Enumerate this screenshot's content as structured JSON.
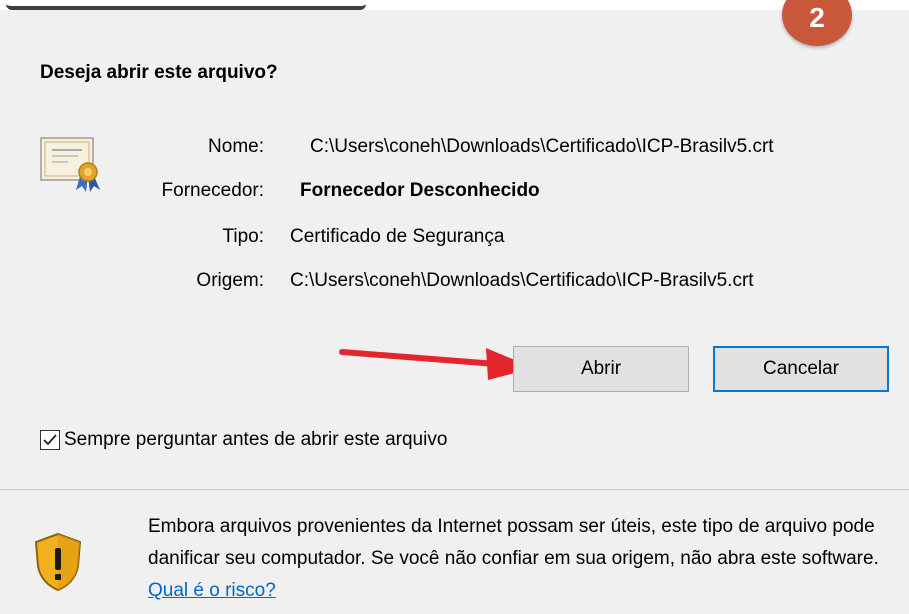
{
  "step_badge": "2",
  "dialog": {
    "title": "Deseja abrir este arquivo?",
    "fields": [
      {
        "label": "Nome:",
        "value": "C:\\Users\\coneh\\Downloads\\Certificado\\ICP-Brasilv5.crt",
        "bold": false
      },
      {
        "label": "Fornecedor:",
        "value": "Fornecedor Desconhecido",
        "bold": true
      },
      {
        "label": "Tipo:",
        "value": "Certificado de Segurança",
        "bold": false
      },
      {
        "label": "Origem:",
        "value": "C:\\Users\\coneh\\Downloads\\Certificado\\ICP-Brasilv5.crt",
        "bold": false
      }
    ],
    "buttons": {
      "open_label": "Abrir",
      "cancel_label": "Cancelar"
    },
    "checkbox": {
      "label": "Sempre perguntar antes de abrir este arquivo",
      "checked": true
    },
    "warning": {
      "text": "Embora arquivos provenientes da Internet possam ser úteis, este tipo de arquivo pode danificar seu computador. Se você não confiar em sua origem, não abra este software.",
      "link_label": "Qual é o risco?"
    }
  },
  "colors": {
    "accent": "#0078d7",
    "badge": "#c9573b",
    "arrow": "#e3262b",
    "link": "#0066cc"
  },
  "icons": [
    "certificate-icon",
    "shield-warning-icon",
    "checkmark-icon",
    "annotation-arrow"
  ]
}
